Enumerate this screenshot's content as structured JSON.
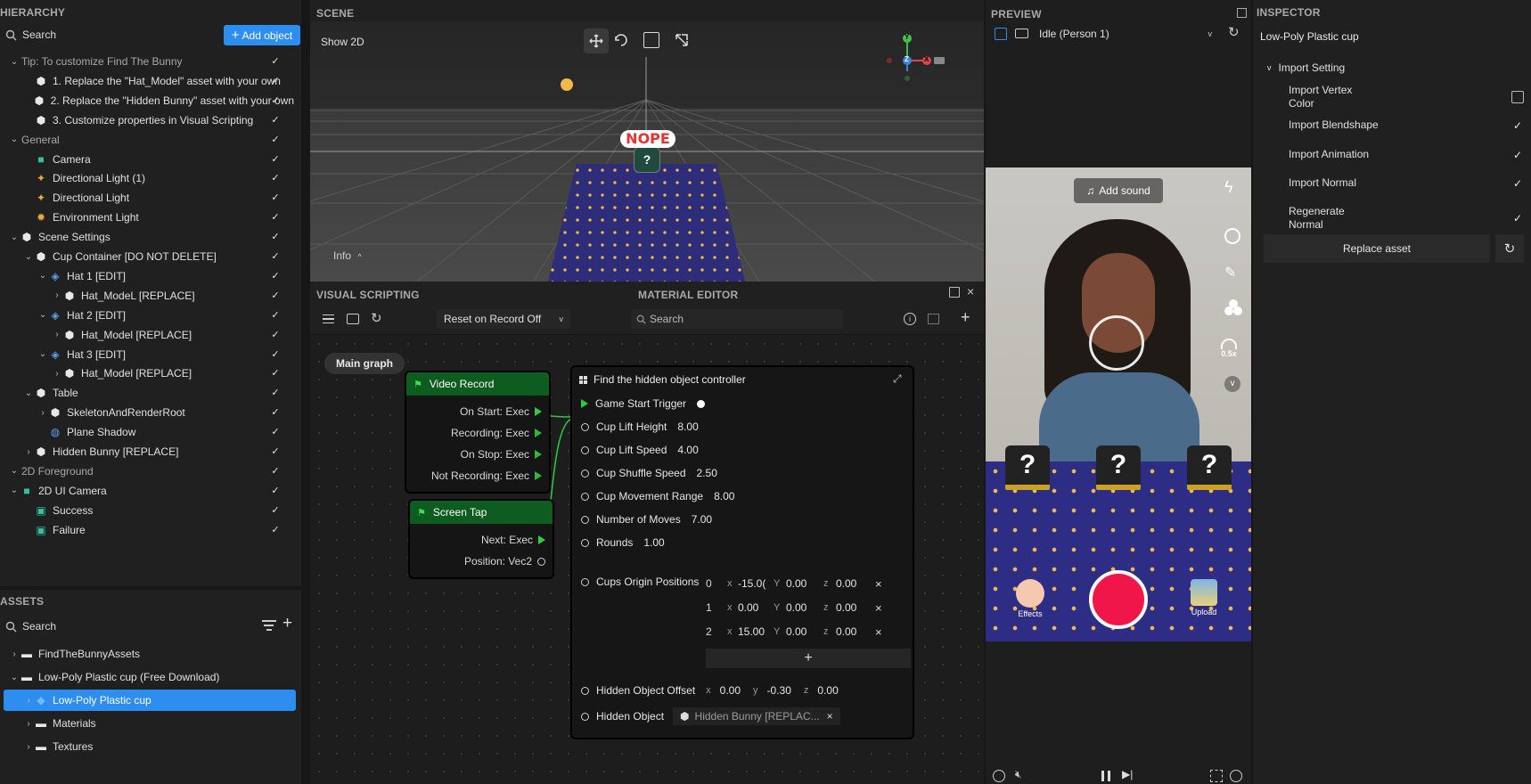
{
  "hierarchy": {
    "title": "HIERARCHY",
    "search_placeholder": "Search",
    "add_button": "Add object",
    "items": [
      {
        "label": "Tip: To customize Find The Bunny",
        "depth": 0,
        "chevron": "down",
        "icon": "",
        "muted": true
      },
      {
        "label": "1. Replace the \"Hat_Model\" asset with your own",
        "depth": 1,
        "chevron": "",
        "icon": "object-icon"
      },
      {
        "label": "2. Replace the \"Hidden Bunny\" asset with your own",
        "depth": 1,
        "chevron": "",
        "icon": "object-icon"
      },
      {
        "label": "3. Customize properties in Visual Scripting",
        "depth": 1,
        "chevron": "",
        "icon": "object-icon"
      },
      {
        "label": "General",
        "depth": 0,
        "chevron": "down",
        "icon": "",
        "muted": true
      },
      {
        "label": "Camera",
        "depth": 1,
        "chevron": "",
        "icon": "camera-icon"
      },
      {
        "label": "Directional Light (1)",
        "depth": 1,
        "chevron": "",
        "icon": "light-icon"
      },
      {
        "label": "Directional Light",
        "depth": 1,
        "chevron": "",
        "icon": "light-icon"
      },
      {
        "label": "Environment Light",
        "depth": 1,
        "chevron": "",
        "icon": "sun-icon"
      },
      {
        "label": "Scene Settings",
        "depth": 0,
        "chevron": "down",
        "icon": "object-icon"
      },
      {
        "label": "Cup Container [DO NOT DELETE]",
        "depth": 1,
        "chevron": "down",
        "icon": "object-icon"
      },
      {
        "label": "Hat 1 [EDIT]",
        "depth": 2,
        "chevron": "down",
        "icon": "prefab-icon"
      },
      {
        "label": "Hat_ModeL [REPLACE]",
        "depth": 3,
        "chevron": "right",
        "icon": "object-icon"
      },
      {
        "label": "Hat 2 [EDIT]",
        "depth": 2,
        "chevron": "down",
        "icon": "prefab-icon"
      },
      {
        "label": "Hat_Model [REPLACE]",
        "depth": 3,
        "chevron": "right",
        "icon": "object-icon"
      },
      {
        "label": "Hat 3 [EDIT]",
        "depth": 2,
        "chevron": "down",
        "icon": "prefab-icon"
      },
      {
        "label": "Hat_Model [REPLACE]",
        "depth": 3,
        "chevron": "right",
        "icon": "object-icon"
      },
      {
        "label": "Table",
        "depth": 1,
        "chevron": "down",
        "icon": "object-icon"
      },
      {
        "label": "SkeletonAndRenderRoot",
        "depth": 2,
        "chevron": "right",
        "icon": "object-icon"
      },
      {
        "label": "Plane Shadow",
        "depth": 2,
        "chevron": "",
        "icon": "globe-icon"
      },
      {
        "label": "Hidden Bunny [REPLACE]",
        "depth": 1,
        "chevron": "right",
        "icon": "object-icon"
      },
      {
        "label": "2D Foreground",
        "depth": 0,
        "chevron": "down",
        "icon": "",
        "muted": true
      },
      {
        "label": "2D UI Camera",
        "depth": 0,
        "chevron": "down",
        "icon": "camera-icon"
      },
      {
        "label": "Success",
        "depth": 1,
        "chevron": "",
        "icon": "image-icon"
      },
      {
        "label": "Failure",
        "depth": 1,
        "chevron": "",
        "icon": "image-icon"
      }
    ]
  },
  "assets": {
    "title": "ASSETS",
    "search_placeholder": "Search",
    "items": [
      {
        "label": "FindTheBunnyAssets",
        "depth": 0,
        "chevron": "right",
        "icon": "folder-icon"
      },
      {
        "label": "Low-Poly Plastic cup (Free Download)",
        "depth": 0,
        "chevron": "down",
        "icon": "folder-icon"
      },
      {
        "label": "Low-Poly Plastic cup",
        "depth": 1,
        "chevron": "right",
        "icon": "mesh-icon",
        "selected": true
      },
      {
        "label": "Materials",
        "depth": 1,
        "chevron": "right",
        "icon": "folder-icon"
      },
      {
        "label": "Textures",
        "depth": 1,
        "chevron": "right",
        "icon": "folder-icon"
      }
    ]
  },
  "scene": {
    "title": "SCENE",
    "show2d": "Show 2D",
    "info": "Info",
    "sign_text": "NOPE",
    "gizmo_y": "Y",
    "gizmo_z": "Z",
    "gizmo_x": "X"
  },
  "visual_scripting": {
    "title": "VISUAL SCRIPTING",
    "reset_dropdown": "Reset on Record Off",
    "main_graph": "Main graph",
    "video_record": {
      "title": "Video Record",
      "outputs": [
        "On Start: Exec",
        "Recording: Exec",
        "On Stop: Exec",
        "Not Recording: Exec"
      ]
    },
    "screen_tap": {
      "title": "Screen Tap",
      "outputs": [
        "Next: Exec",
        "Position: Vec2"
      ]
    },
    "controller": {
      "title": "Find the hidden object controller",
      "trigger": "Game Start Trigger",
      "props": [
        {
          "label": "Cup Lift Height",
          "value": "8.00"
        },
        {
          "label": "Cup Lift Speed",
          "value": "4.00"
        },
        {
          "label": "Cup Shuffle Speed",
          "value": "2.50"
        },
        {
          "label": "Cup Movement Range",
          "value": "8.00"
        },
        {
          "label": "Number of Moves",
          "value": "7.00"
        },
        {
          "label": "Rounds",
          "value": "1.00"
        }
      ],
      "origins_label": "Cups Origin Positions",
      "origins": [
        {
          "index": "0",
          "x": "-15.0(",
          "y": "0.00",
          "z": "0.00"
        },
        {
          "index": "1",
          "x": "0.00",
          "y": "0.00",
          "z": "0.00"
        },
        {
          "index": "2",
          "x": "15.00",
          "y": "0.00",
          "z": "0.00"
        }
      ],
      "offset_label": "Hidden Object Offset",
      "offset": {
        "x": "0.00",
        "y": "-0.30",
        "z": "0.00"
      },
      "hidden_object_label": "Hidden Object",
      "hidden_object_value": "Hidden Bunny [REPLAC..."
    }
  },
  "material_editor": {
    "title": "MATERIAL EDITOR",
    "search_placeholder": "Search"
  },
  "preview": {
    "title": "PREVIEW",
    "dropdown": "Idle (Person 1)",
    "add_sound": "Add sound",
    "speed": "0.5x",
    "effects": "Effects",
    "upload": "Upload",
    "record_color": "#f0164a"
  },
  "inspector": {
    "title": "INSPECTOR",
    "object_name": "Low-Poly Plastic cup",
    "section": "Import Setting",
    "rows": [
      {
        "label": "Import Vertex\nColor",
        "checked": false
      },
      {
        "label": "Import Blendshape",
        "checked": true
      },
      {
        "label": "Import Animation",
        "checked": true
      },
      {
        "label": "Import Normal",
        "checked": true
      },
      {
        "label": "Regenerate\nNormal",
        "checked": true
      }
    ],
    "replace_button": "Replace asset"
  },
  "colors": {
    "accent": "#2d8ef0",
    "node_header": "#0f5c20",
    "selected_row": "#2d8ef0"
  }
}
